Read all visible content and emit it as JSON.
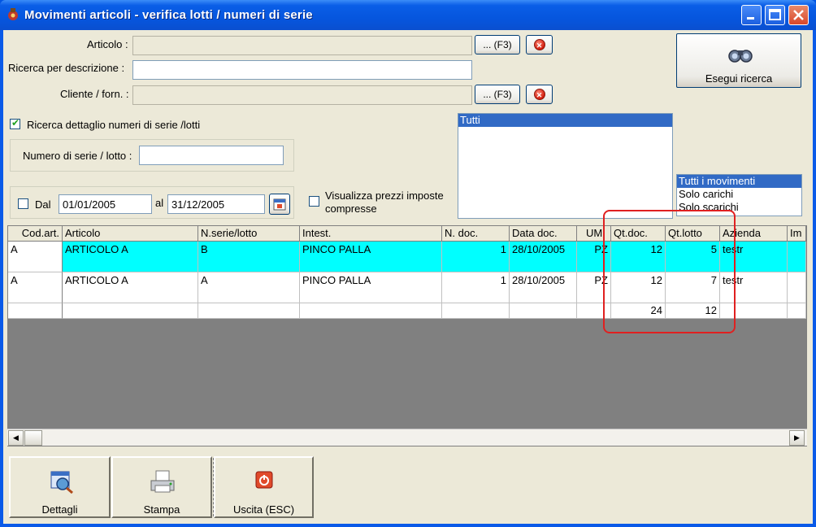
{
  "window": {
    "title": "Movimenti articoli - verifica lotti / numeri di serie"
  },
  "filters": {
    "articolo_label": "Articolo :",
    "articolo_lookup_button": "... (F3)",
    "descrizione_label": "Ricerca per descrizione :",
    "cliente_label": "Cliente / forn. :",
    "cliente_lookup_button": "... (F3)",
    "dettaglio_checkbox_label": "Ricerca dettaglio numeri di serie /lotti",
    "seriale_label": "Numero di serie / lotto :",
    "dal_label": "Dal",
    "dal_value": "01/01/2005",
    "al_label": "al",
    "al_value": "31/12/2005",
    "prezzi_checkbox_label_line1": "Visualizza prezzi imposte",
    "prezzi_checkbox_label_line2": "compresse"
  },
  "search_button": {
    "label": "Esegui ricerca"
  },
  "list_tutti": {
    "items": [
      "Tutti"
    ]
  },
  "list_movimenti": {
    "items": [
      "Tutti i movimenti",
      "Solo carichi",
      "Solo scarichi"
    ]
  },
  "grid": {
    "columns": [
      "Cod.art.",
      "Articolo",
      "N.serie/lotto",
      "Intest.",
      "N. doc.",
      "Data doc.",
      "UM",
      "Qt.doc.",
      "Qt.lotto",
      "Azienda",
      "Im"
    ],
    "rows": [
      {
        "cod": "A",
        "articolo": "ARTICOLO A",
        "serie": "B",
        "intest": "PINCO PALLA",
        "ndoc": "1",
        "data": "28/10/2005",
        "um": "PZ",
        "qtdoc": "12",
        "qtlotto": "5",
        "azienda": "testr"
      },
      {
        "cod": "A",
        "articolo": "ARTICOLO A",
        "serie": "A",
        "intest": "PINCO PALLA",
        "ndoc": "1",
        "data": "28/10/2005",
        "um": "PZ",
        "qtdoc": "12",
        "qtlotto": "7",
        "azienda": "testr"
      }
    ],
    "totals": {
      "qtdoc": "24",
      "qtlotto": "12"
    }
  },
  "toolbar": {
    "dettagli": "Dettagli",
    "stampa": "Stampa",
    "uscita": "Uscita (ESC)"
  },
  "colors": {
    "selected_row": "#00ffff",
    "highlight_box": "#e02020",
    "list_selection": "#316ac5"
  }
}
